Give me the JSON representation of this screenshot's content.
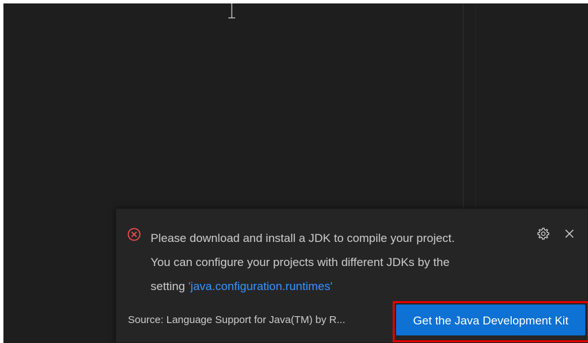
{
  "notification": {
    "line1": "Please download and install a JDK to compile your project.",
    "line2": "You can configure your projects with different JDKs by the",
    "line3_prefix": "setting ",
    "link_text": "'java.configuration.runtimes'",
    "source": "Source: Language Support for Java(TM) by R...",
    "primary_action": "Get the Java Development Kit",
    "icons": {
      "status": "error-circle-icon",
      "settings": "gear-icon",
      "close": "close-icon",
      "cursor": "text-cursor-icon"
    }
  },
  "colors": {
    "editor_bg": "#1e1e1e",
    "toast_bg": "#252526",
    "text": "#cccccc",
    "link": "#3794ff",
    "error": "#f14c4c",
    "button_bg": "#0e71d4",
    "highlight": "#e00000"
  }
}
